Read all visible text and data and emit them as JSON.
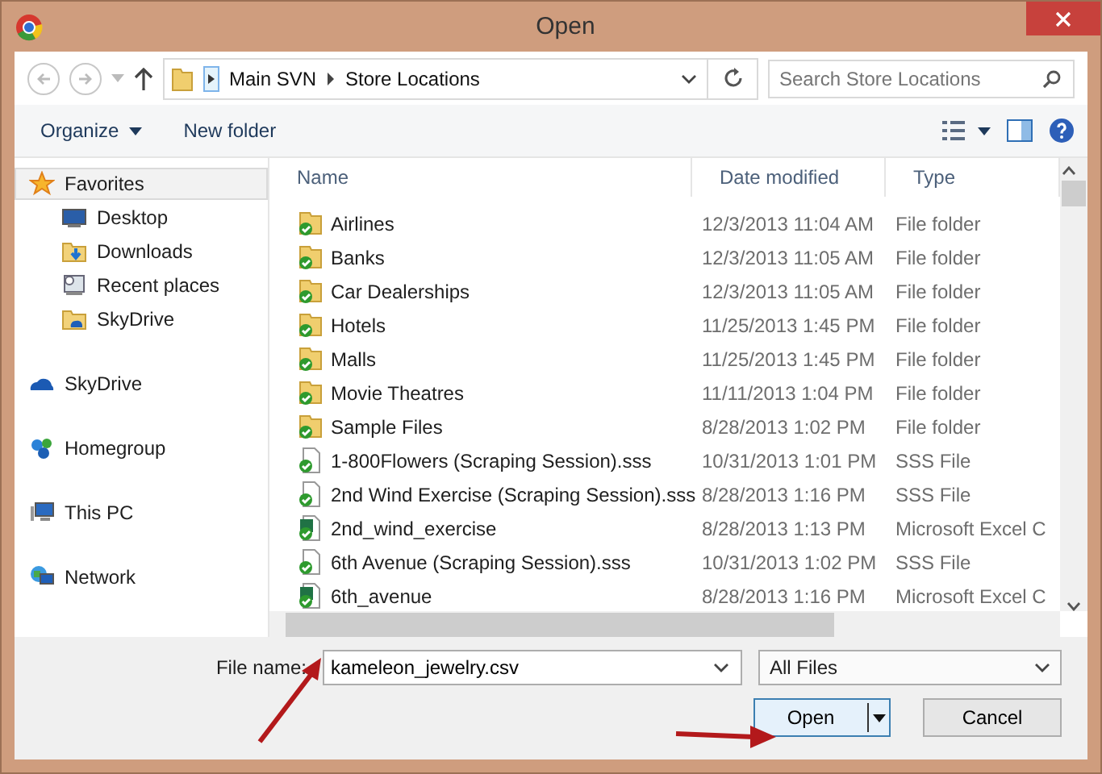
{
  "window": {
    "title": "Open"
  },
  "address_bar": {
    "path": [
      "Main SVN",
      "Store Locations"
    ]
  },
  "search": {
    "placeholder": "Search Store Locations"
  },
  "toolbar": {
    "organize": "Organize",
    "new_folder": "New folder"
  },
  "navigation": [
    {
      "label": "Favorites",
      "kind": "favorites",
      "selected": true,
      "children": [
        {
          "label": "Desktop",
          "kind": "desktop",
          "selected": false
        },
        {
          "label": "Downloads",
          "kind": "downloads",
          "selected": false
        },
        {
          "label": "Recent places",
          "kind": "recent",
          "selected": false
        },
        {
          "label": "SkyDrive",
          "kind": "skyfolder",
          "selected": false
        }
      ]
    },
    {
      "label": "SkyDrive",
      "kind": "skydrive",
      "selected": false
    },
    {
      "label": "Homegroup",
      "kind": "homegroup",
      "selected": false
    },
    {
      "label": "This PC",
      "kind": "pc",
      "selected": false
    },
    {
      "label": "Network",
      "kind": "network",
      "selected": false
    }
  ],
  "table": {
    "columns": [
      "Name",
      "Date modified",
      "Type"
    ],
    "rows": [
      {
        "name": "Airlines",
        "date": "12/3/2013 11:04 AM",
        "type": "File folder",
        "kind": "folder"
      },
      {
        "name": "Banks",
        "date": "12/3/2013 11:05 AM",
        "type": "File folder",
        "kind": "folder"
      },
      {
        "name": "Car Dealerships",
        "date": "12/3/2013 11:05 AM",
        "type": "File folder",
        "kind": "folder"
      },
      {
        "name": "Hotels",
        "date": "11/25/2013 1:45 PM",
        "type": "File folder",
        "kind": "folder"
      },
      {
        "name": "Malls",
        "date": "11/25/2013 1:45 PM",
        "type": "File folder",
        "kind": "folder"
      },
      {
        "name": "Movie Theatres",
        "date": "11/11/2013 1:04 PM",
        "type": "File folder",
        "kind": "folder"
      },
      {
        "name": "Sample Files",
        "date": "8/28/2013 1:02 PM",
        "type": "File folder",
        "kind": "folder"
      },
      {
        "name": "1-800Flowers (Scraping Session).sss",
        "date": "10/31/2013 1:01 PM",
        "type": "SSS File",
        "kind": "file"
      },
      {
        "name": "2nd Wind Exercise (Scraping Session).sss",
        "date": "8/28/2013 1:16 PM",
        "type": "SSS File",
        "kind": "file"
      },
      {
        "name": "2nd_wind_exercise",
        "date": "8/28/2013 1:13 PM",
        "type": "Microsoft Excel C",
        "kind": "excel"
      },
      {
        "name": "6th Avenue (Scraping Session).sss",
        "date": "10/31/2013 1:02 PM",
        "type": "SSS File",
        "kind": "file"
      },
      {
        "name": "6th_avenue",
        "date": "8/28/2013 1:16 PM",
        "type": "Microsoft Excel C",
        "kind": "excel"
      }
    ]
  },
  "file_name": {
    "label": "File name:",
    "value": "kameleon_jewelry.csv"
  },
  "file_type": {
    "value": "All Files"
  },
  "buttons": {
    "open": "Open",
    "cancel": "Cancel"
  }
}
